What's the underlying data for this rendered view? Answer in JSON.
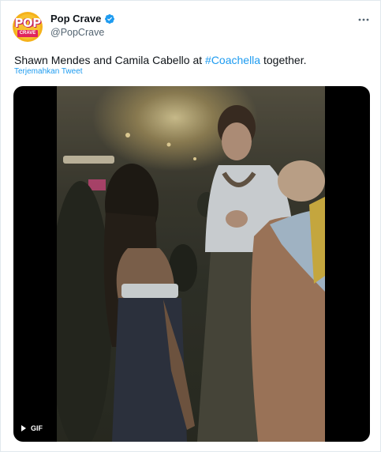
{
  "author": {
    "display_name": "Pop Crave",
    "handle": "@PopCrave",
    "avatar_text_top": "POP",
    "avatar_text_bottom": "CRAVE",
    "verified": true
  },
  "tweet": {
    "text_before": "Shawn Mendes and Camila Cabello at ",
    "hashtag": "#Coachella",
    "text_after": " together.",
    "translate_label": "Terjemahkan Tweet"
  },
  "media": {
    "type": "gif",
    "badge_label": "GIF"
  },
  "colors": {
    "link": "#1d9bf0",
    "verified": "#1d9bf0",
    "text": "#0f1419",
    "secondary": "#536471"
  },
  "icons": {
    "verified": "verified-badge-icon",
    "more": "more-horizontal-icon",
    "play": "play-icon"
  }
}
